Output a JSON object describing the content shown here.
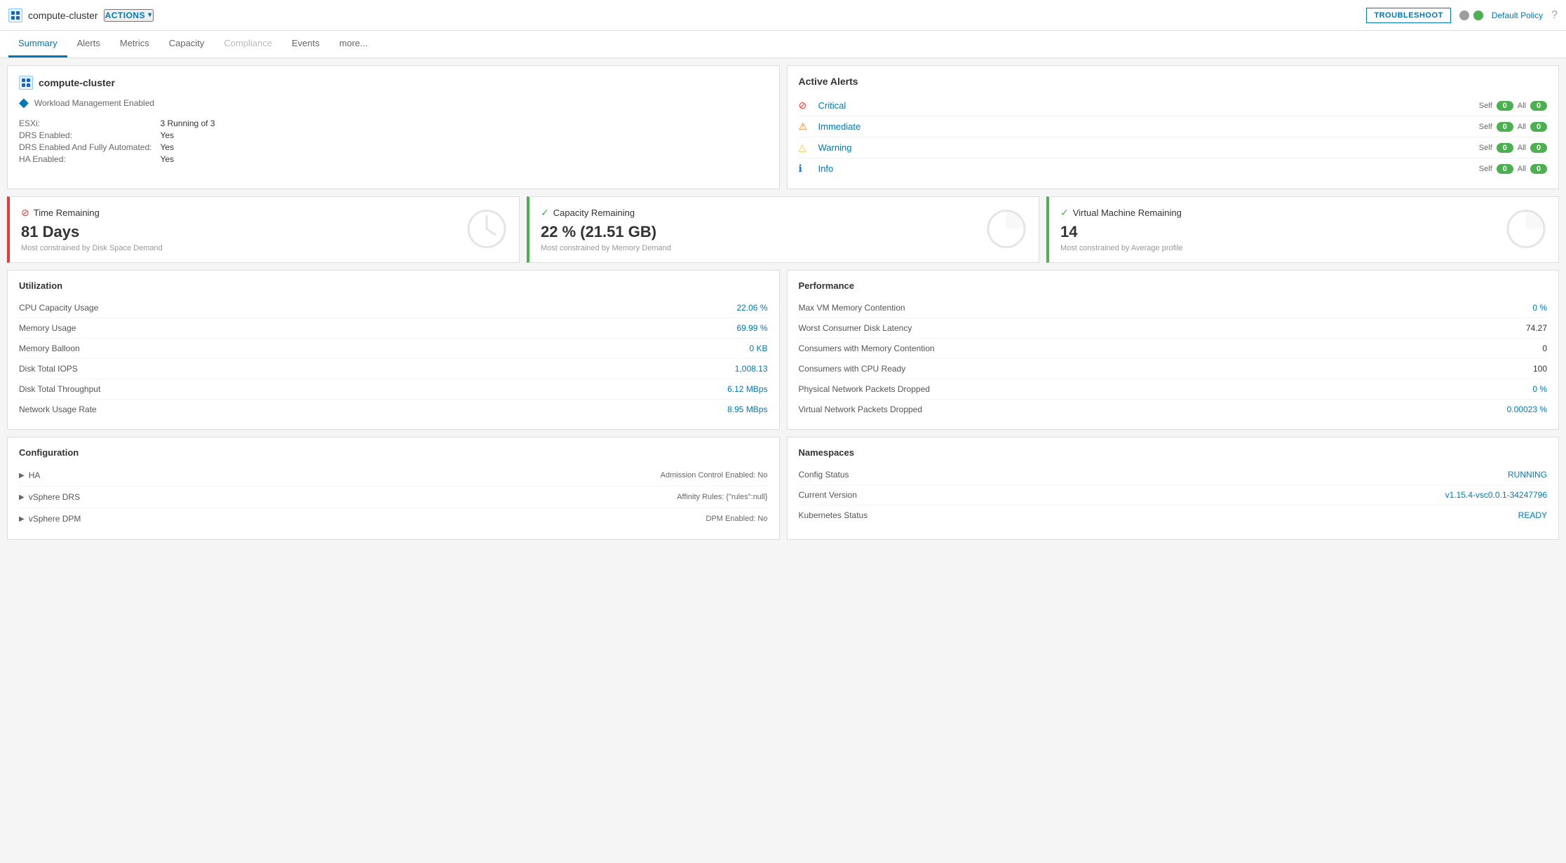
{
  "topbar": {
    "cluster_name": "compute-cluster",
    "actions_label": "ACTIONS",
    "troubleshoot_label": "TROUBLESHOOT",
    "default_policy_label": "Default Policy"
  },
  "tabs": [
    {
      "label": "Summary",
      "active": true,
      "disabled": false
    },
    {
      "label": "Alerts",
      "active": false,
      "disabled": false
    },
    {
      "label": "Metrics",
      "active": false,
      "disabled": false
    },
    {
      "label": "Capacity",
      "active": false,
      "disabled": false
    },
    {
      "label": "Compliance",
      "active": false,
      "disabled": true
    },
    {
      "label": "Events",
      "active": false,
      "disabled": false
    },
    {
      "label": "more...",
      "active": false,
      "disabled": false
    }
  ],
  "cluster_info": {
    "title": "compute-cluster",
    "workload_text": "Workload Management Enabled",
    "esxi_label": "ESXi:",
    "esxi_value": "3 Running of 3",
    "drs_label": "DRS Enabled:",
    "drs_value": "Yes",
    "drs_auto_label": "DRS Enabled And Fully Automated:",
    "drs_auto_value": "Yes",
    "ha_label": "HA Enabled:",
    "ha_value": "Yes"
  },
  "active_alerts": {
    "title": "Active Alerts",
    "alerts": [
      {
        "icon": "critical",
        "name": "Critical",
        "self_count": "0",
        "all_count": "0"
      },
      {
        "icon": "immediate",
        "name": "Immediate",
        "self_count": "0",
        "all_count": "0"
      },
      {
        "icon": "warning",
        "name": "Warning",
        "self_count": "0",
        "all_count": "0"
      },
      {
        "icon": "info",
        "name": "Info",
        "self_count": "0",
        "all_count": "0"
      }
    ],
    "self_label": "Self",
    "all_label": "All"
  },
  "metrics": [
    {
      "title": "Time Remaining",
      "value": "81 Days",
      "subtitle": "Most constrained by Disk Space Demand",
      "border": "red",
      "icon": "clock"
    },
    {
      "title": "Capacity Remaining",
      "value": "22 % (21.51 GB)",
      "subtitle": "Most constrained by Memory Demand",
      "border": "green",
      "icon": "pie"
    },
    {
      "title": "Virtual Machine Remaining",
      "value": "14",
      "subtitle": "Most constrained by Average profile",
      "border": "green",
      "icon": "pie"
    }
  ],
  "utilization": {
    "title": "Utilization",
    "rows": [
      {
        "label": "CPU Capacity Usage",
        "value": "22.06 %",
        "blue": true
      },
      {
        "label": "Memory Usage",
        "value": "69.99 %",
        "blue": true
      },
      {
        "label": "Memory Balloon",
        "value": "0 KB",
        "blue": true
      },
      {
        "label": "Disk Total IOPS",
        "value": "1,008.13",
        "blue": true
      },
      {
        "label": "Disk Total Throughput",
        "value": "6.12 MBps",
        "blue": true
      },
      {
        "label": "Network Usage Rate",
        "value": "8.95 MBps",
        "blue": true
      }
    ]
  },
  "performance": {
    "title": "Performance",
    "rows": [
      {
        "label": "Max VM Memory Contention",
        "value": "0 %",
        "blue": true
      },
      {
        "label": "Worst Consumer Disk Latency",
        "value": "74.27",
        "blue": false
      },
      {
        "label": "Consumers with Memory Contention",
        "value": "0",
        "blue": false
      },
      {
        "label": "Consumers with CPU Ready",
        "value": "100",
        "blue": false
      },
      {
        "label": "Physical Network Packets Dropped",
        "value": "0 %",
        "blue": true
      },
      {
        "label": "Virtual Network Packets Dropped",
        "value": "0.00023 %",
        "blue": true
      }
    ]
  },
  "configuration": {
    "title": "Configuration",
    "rows": [
      {
        "name": "HA",
        "detail": "Admission Control Enabled: No"
      },
      {
        "name": "vSphere DRS",
        "detail": "Affinity Rules: {\"rules\":null}"
      },
      {
        "name": "vSphere DPM",
        "detail": "DPM Enabled: No"
      }
    ]
  },
  "namespaces": {
    "title": "Namespaces",
    "rows": [
      {
        "label": "Config Status",
        "value": "RUNNING",
        "blue": true
      },
      {
        "label": "Current Version",
        "value": "v1.15.4-vsc0.0.1-34247796",
        "blue": true
      },
      {
        "label": "Kubernetes Status",
        "value": "READY",
        "blue": true
      }
    ]
  }
}
